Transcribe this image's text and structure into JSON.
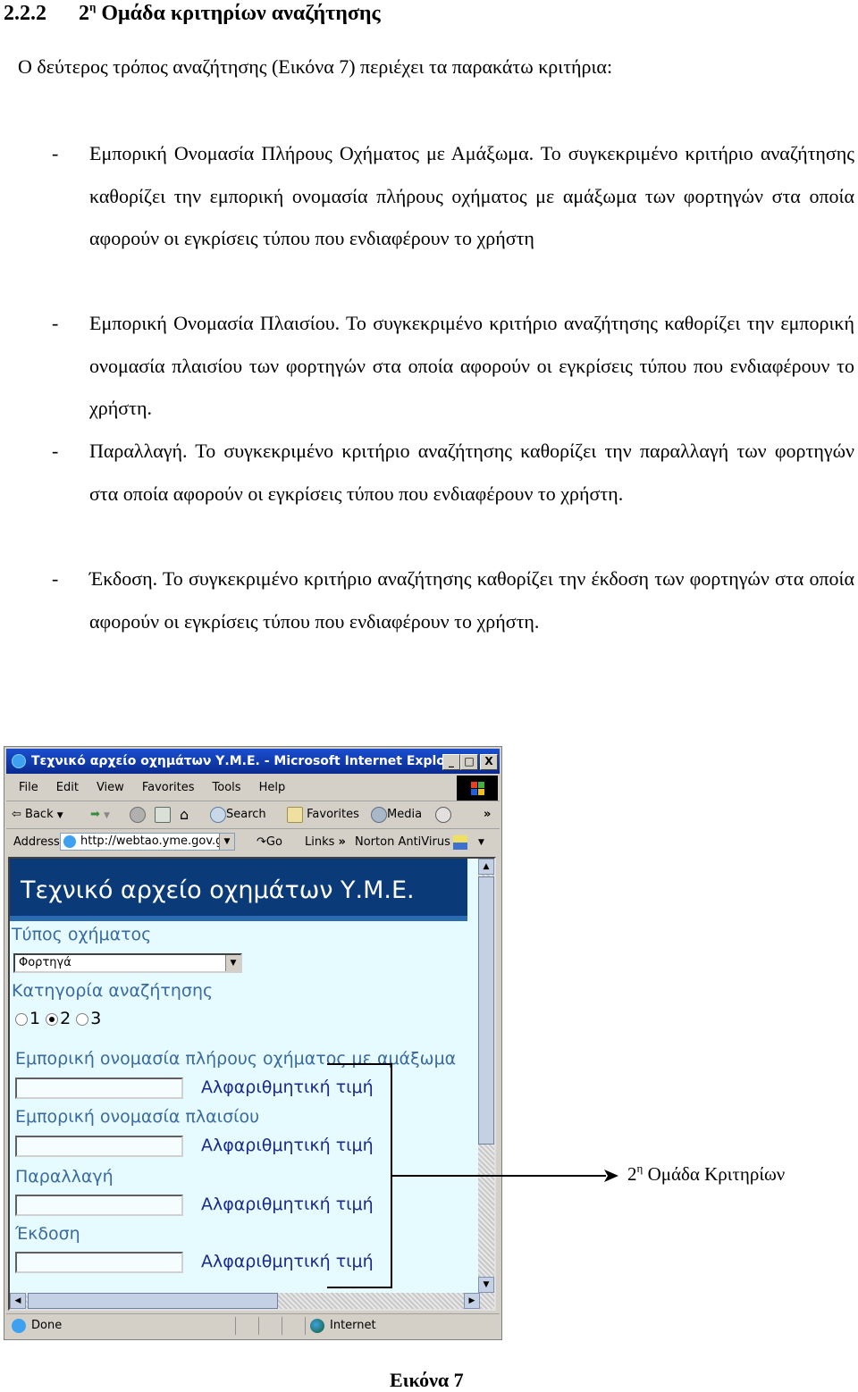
{
  "section": {
    "number": "2.2.2",
    "ordinal": "2",
    "ordinal_sup": "η",
    "title": "Ομάδα κριτηρίων αναζήτησης"
  },
  "intro": "Ο δεύτερος τρόπος αναζήτησης (Εικόνα 7) περιέχει τα παρακάτω κριτήρια:",
  "criteria": [
    {
      "dash": "-",
      "text": "Εμπορική Ονομασία Πλήρους Οχήματος με Αμάξωμα.  Το συγκεκριμένο κριτήριο αναζήτησης καθορίζει την εμπορική ονομασία πλήρους οχήματος με αμάξωμα των φορτηγών στα οποία αφορούν οι εγκρίσεις τύπου που ενδιαφέρουν το χρήστη"
    },
    {
      "dash": "-",
      "text": "Εμπορική Ονομασία Πλαισίου. Το συγκεκριμένο κριτήριο αναζήτησης καθορίζει την εμπορική ονομασία πλαισίου των φορτηγών στα οποία αφορούν οι εγκρίσεις τύπου που ενδιαφέρουν το χρήστη."
    },
    {
      "dash": "-",
      "text": "Παραλλαγή. Το συγκεκριμένο κριτήριο αναζήτησης καθορίζει την παραλλαγή των φορτηγών στα οποία αφορούν οι εγκρίσεις τύπου που ενδιαφέρουν το χρήστη."
    },
    {
      "dash": "-",
      "text": "Έκδοση. Το συγκεκριμένο κριτήριο αναζήτησης καθορίζει την έκδοση των φορτηγών στα οποία αφορούν οι εγκρίσεις τύπου που ενδιαφέρουν το χρήστη."
    }
  ],
  "browser": {
    "window_title": "Τεχνικό αρχείο οχημάτων Υ.Μ.Ε. - Microsoft Internet Explorer",
    "window_buttons": {
      "minimize": "_",
      "maximize": "□",
      "close": "X"
    },
    "menu": [
      "File",
      "Edit",
      "View",
      "Favorites",
      "Tools",
      "Help"
    ],
    "toolbar": {
      "back": "Back",
      "search": "Search",
      "favorites": "Favorites",
      "media": "Media",
      "more": "»"
    },
    "address": {
      "label": "Address",
      "value": "http://webtao.yme.gov.g",
      "go": "Go",
      "links": "Links",
      "links_more": "»",
      "norton": "Norton AntiVirus"
    },
    "status": {
      "text": "Done",
      "zone": "Internet"
    }
  },
  "page": {
    "banner": "Τεχνικό αρχείο οχημάτων Υ.Μ.Ε.",
    "vehicle_type_label": "Τύπος οχήματος",
    "vehicle_type_value": "Φορτηγά",
    "category_label": "Κατηγορία αναζήτησης",
    "categories": [
      {
        "label": "1",
        "selected": false
      },
      {
        "label": "2",
        "selected": true
      },
      {
        "label": "3",
        "selected": false
      }
    ],
    "fields": [
      {
        "label": "Εμπορική ονομασία πλήρους οχήματος με αμάξωμα",
        "value": "",
        "hint": "Αλφαριθμητική τιμή"
      },
      {
        "label": "Εμπορική ονομασία πλαισίου",
        "value": "",
        "hint": "Αλφαριθμητική τιμή"
      },
      {
        "label": "Παραλλαγή",
        "value": "",
        "hint": "Αλφαριθμητική τιμή"
      },
      {
        "label": "Έκδοση",
        "value": "",
        "hint": "Αλφαριθμητική τιμή"
      }
    ]
  },
  "callout": {
    "ordinal": "2",
    "ordinal_sup": "η",
    "text": "Ομάδα Κριτηρίων"
  },
  "caption": "Εικόνα 7"
}
